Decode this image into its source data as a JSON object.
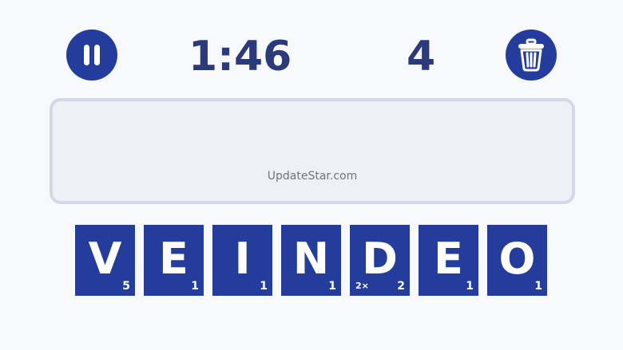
{
  "hud": {
    "timer": "1:46",
    "score": "4"
  },
  "answer_area": {
    "watermark": "UpdateStar.com"
  },
  "tiles": [
    {
      "letter": "V",
      "points": "5",
      "multiplier": ""
    },
    {
      "letter": "E",
      "points": "1",
      "multiplier": ""
    },
    {
      "letter": "I",
      "points": "1",
      "multiplier": ""
    },
    {
      "letter": "N",
      "points": "1",
      "multiplier": ""
    },
    {
      "letter": "D",
      "points": "2",
      "multiplier": "2×"
    },
    {
      "letter": "E",
      "points": "1",
      "multiplier": ""
    },
    {
      "letter": "O",
      "points": "1",
      "multiplier": ""
    }
  ],
  "colors": {
    "accent": "#243c9c",
    "text": "#2b3a7a",
    "background": "#f8f9fc",
    "answer_box": "#eff0f6"
  },
  "icons": {
    "pause": "pause-icon",
    "trash": "trash-icon"
  }
}
